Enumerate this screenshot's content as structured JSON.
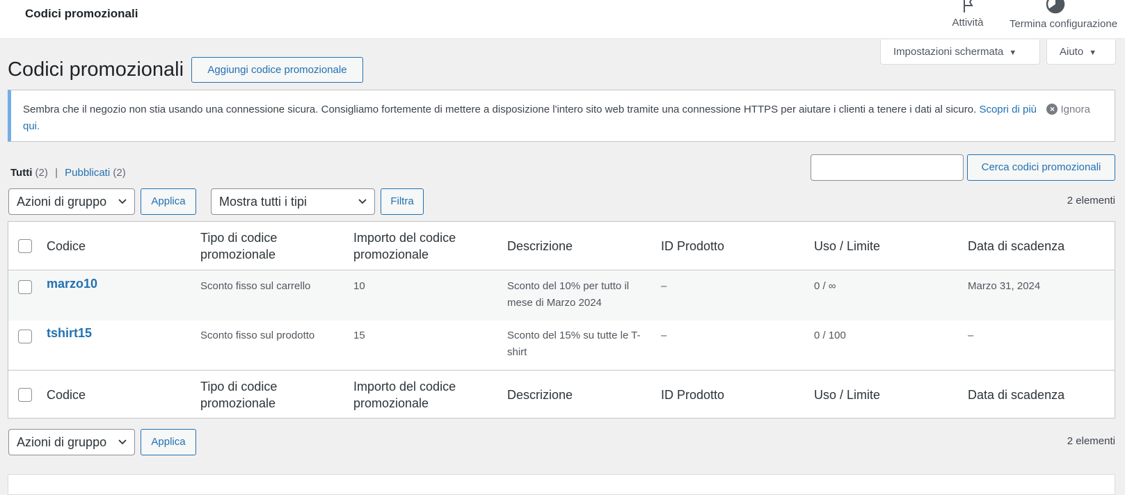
{
  "header": {
    "title": "Codici promozionali",
    "activity_label": "Attività",
    "finish_setup_label": "Termina configurazione"
  },
  "screen_meta": {
    "screen_options_label": "Impostazioni schermata",
    "help_label": "Aiuto"
  },
  "page": {
    "title": "Codici promozionali",
    "add_button_label": "Aggiungi codice promozionale"
  },
  "notice": {
    "text": "Sembra che il negozio non stia usando una connessione sicura. Consigliamo fortemente di mettere a disposizione l'intero sito web tramite una connessione HTTPS per aiutare i clienti a tenere i dati al sicuro.",
    "link_label": "Scopri di più qui.",
    "dismiss_label": "Ignora"
  },
  "views": {
    "all_label": "Tutti",
    "all_count": "(2)",
    "separator": "|",
    "published_label": "Pubblicati",
    "published_count": "(2)"
  },
  "search": {
    "value": "",
    "button_label": "Cerca codici promozionali"
  },
  "tablenav": {
    "bulk_actions_label": "Azioni di gruppo",
    "apply_label": "Applica",
    "type_filter_label": "Mostra tutti i tipi",
    "filter_label": "Filtra",
    "items_count": "2 elementi"
  },
  "table": {
    "columns": {
      "code": "Codice",
      "type": "Tipo di codice promozionale",
      "amount": "Importo del codice promozionale",
      "description": "Descrizione",
      "product_ids": "ID Prodotto",
      "usage": "Uso / Limite",
      "expiry": "Data di scadenza"
    },
    "rows": [
      {
        "code": "marzo10",
        "type": "Sconto fisso sul carrello",
        "amount": "10",
        "description": "Sconto del 10% per tutto il mese di Marzo 2024",
        "product_ids": "–",
        "usage": "0 / ∞",
        "expiry": "Marzo 31, 2024"
      },
      {
        "code": "tshirt15",
        "type": "Sconto fisso sul prodotto",
        "amount": "15",
        "description": "Sconto del 15% su tutte le T-shirt",
        "product_ids": "–",
        "usage": "0 / 100",
        "expiry": "–"
      }
    ]
  },
  "colors": {
    "accent": "#2271b1",
    "notice_border": "#72aee6",
    "background": "#f0f0f1"
  }
}
